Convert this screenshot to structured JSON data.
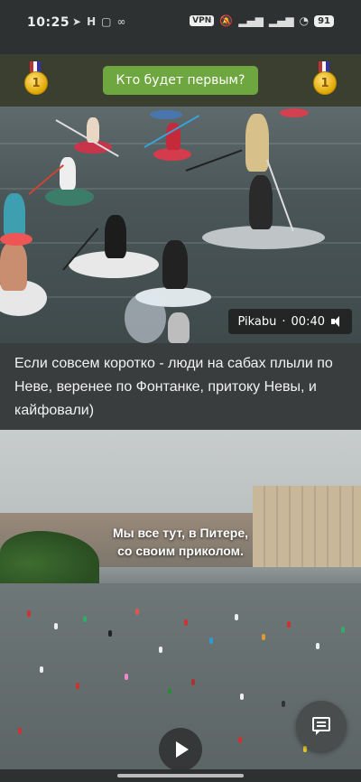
{
  "status_bar": {
    "time": "10:25",
    "left_icons": [
      "telegram-icon",
      "h-icon",
      "instagram-icon",
      "infinity-icon"
    ],
    "vpn": "VPN",
    "right_icons": [
      "mute-icon",
      "signal-icon",
      "signal-icon",
      "wifi-icon"
    ],
    "battery": "91"
  },
  "top_bar": {
    "button_label": "Кто будет первым?",
    "medal_left_number": "1",
    "medal_right_number": "1"
  },
  "video1": {
    "source": "Pikabu",
    "separator": " · ",
    "duration": "00:40"
  },
  "post": {
    "caption": "Если совсем коротко - люди на сабах плыли по Неве, веренее по Фонтанке, притоку Невы, и кайфовали)"
  },
  "video2": {
    "subtitle_line1": "Мы все тут, в Питере,",
    "subtitle_line2": "со своим приколом."
  },
  "colors": {
    "accent_button": "#6ea63f",
    "background": "#3a3d3e"
  }
}
